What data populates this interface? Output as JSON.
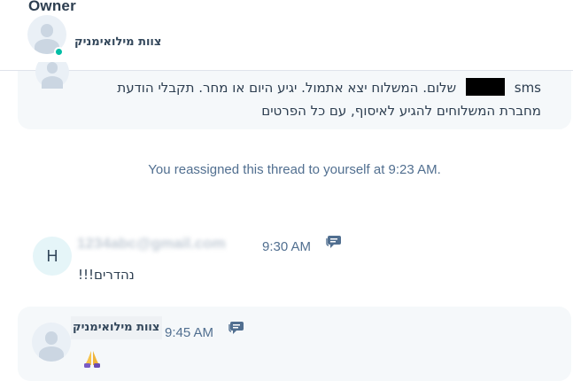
{
  "header": {
    "owner_label": "Owner",
    "owner_name": "צוות מילואימניק",
    "status_color": "#00bda5"
  },
  "messages": [
    {
      "channel": "sms",
      "line1_after_redaction": "שלום. המשלוח יצא אתמול. יגיע היום או מחר. תקבלי הודעת",
      "line2": "מחברת המשלוחים להגיע לאיסוף, עם כל הפרטים"
    },
    {
      "avatar_initial": "H",
      "sender_email": "1234abc@gmail.com",
      "time": "9:30 AM",
      "text": "נהדרים!!!"
    },
    {
      "sender_name": "צוות מילואימניק",
      "time": "9:45 AM",
      "emoji": "folded-hands-icon"
    }
  ],
  "system_note": "You reassigned this thread to yourself at 9:23 AM.",
  "colors": {
    "bubble_bg": "#f5f8fa",
    "muted_text": "#516f90",
    "text": "#2d3e50",
    "chat_icon": "#516f90"
  }
}
